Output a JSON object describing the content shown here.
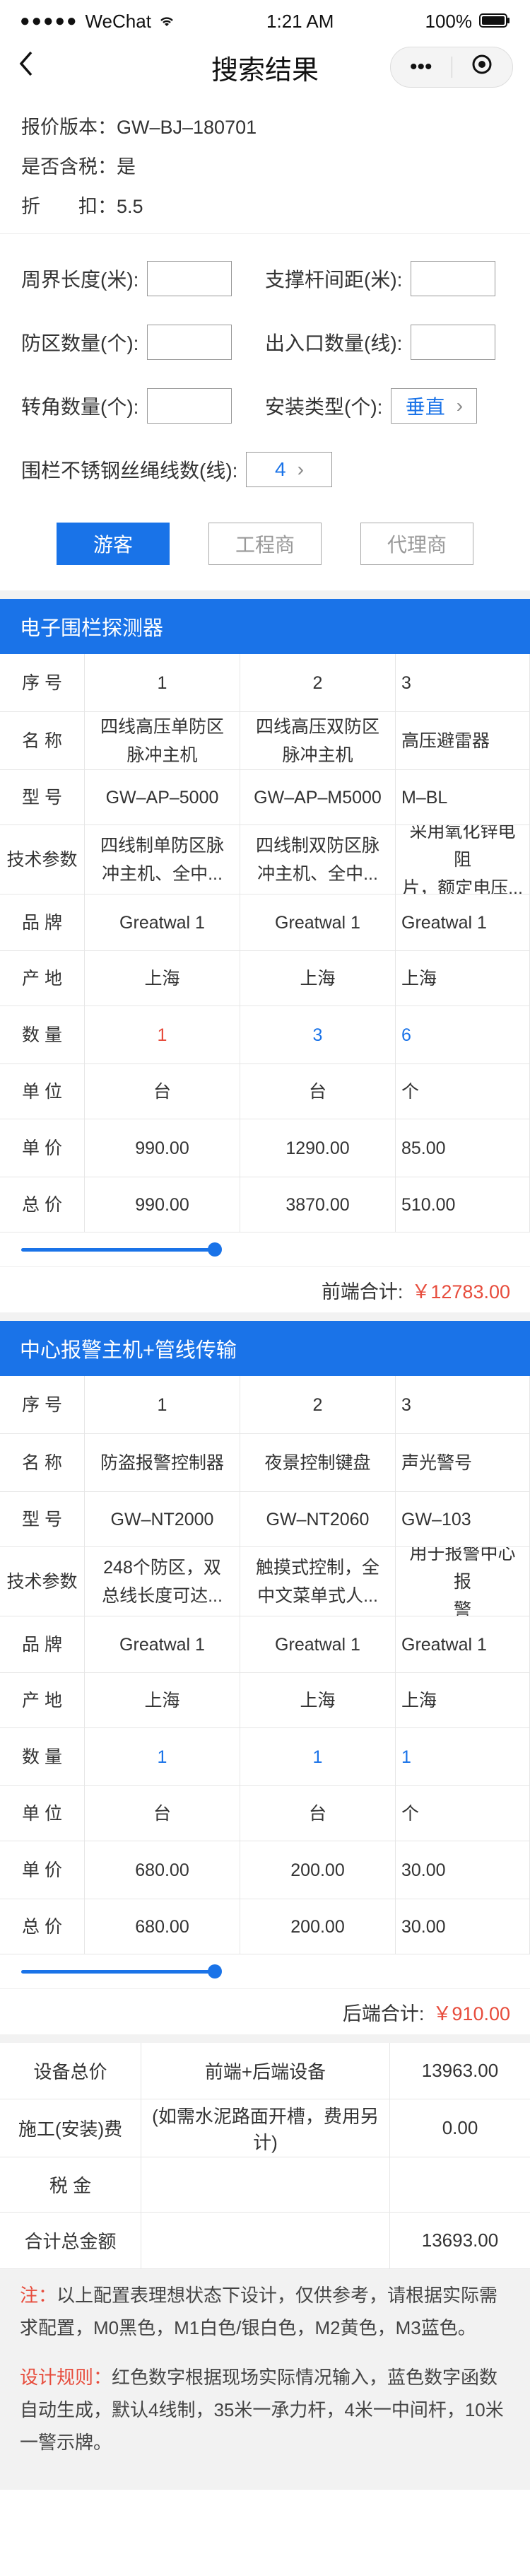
{
  "status": {
    "carrier": "WeChat",
    "time": "1:21 AM",
    "battery": "100%"
  },
  "nav": {
    "title": "搜索结果",
    "capsule_more": "•••",
    "capsule_close": "⊙"
  },
  "info": {
    "version_label": "报价版本：",
    "version": "GW–BJ–180701",
    "tax_label": "是否含税：",
    "tax": "是",
    "discount_label": "折　　扣：",
    "discount": "5.5"
  },
  "form": {
    "perimeter_label": "周界长度(米):",
    "pole_label": "支撑杆间距(米):",
    "zones_label": "防区数量(个):",
    "gates_label": "出入口数量(线):",
    "corners_label": "转角数量(个):",
    "install_label": "安装类型(个):",
    "install_value": "垂直",
    "wires_label": "围栏不锈钢丝绳线数(线):",
    "wires_value": "4"
  },
  "roles": {
    "tourist": "游客",
    "engineer": "工程商",
    "agent": "代理商"
  },
  "section1": {
    "title": "电子围栏探测器",
    "rows": [
      {
        "label": "序  号",
        "cells": [
          "1",
          "2",
          "3"
        ]
      },
      {
        "label": "名  称",
        "cells": [
          "四线高压单防区\n脉冲主机",
          "四线高压双防区\n脉冲主机",
          "高压避雷器"
        ]
      },
      {
        "label": "型  号",
        "cells": [
          "GW–AP–5000",
          "GW–AP–M5000",
          "M–BL"
        ]
      },
      {
        "label": "技术参数",
        "cells": [
          "四线制单防区脉\n冲主机、全中...",
          "四线制双防区脉\n冲主机、全中...",
          "采用氧化锌电阻\n片，额定电压..."
        ]
      },
      {
        "label": "品  牌",
        "cells": [
          "Greatwal 1",
          "Greatwal 1",
          "Greatwal 1"
        ]
      },
      {
        "label": "产  地",
        "cells": [
          "上海",
          "上海",
          "上海"
        ]
      },
      {
        "label": "数  量",
        "cells": [
          "1",
          "3",
          "6"
        ]
      },
      {
        "label": "单  位",
        "cells": [
          "台",
          "台",
          "个"
        ]
      },
      {
        "label": "单  价",
        "cells": [
          "990.00",
          "1290.00",
          "85.00"
        ]
      },
      {
        "label": "总  价",
        "cells": [
          "990.00",
          "3870.00",
          "510.00"
        ]
      }
    ],
    "subtotal_label": "前端合计:",
    "subtotal": "￥12783.00"
  },
  "section2": {
    "title": "中心报警主机+管线传输",
    "rows": [
      {
        "label": "序  号",
        "cells": [
          "1",
          "2",
          "3"
        ]
      },
      {
        "label": "名  称",
        "cells": [
          "防盗报警控制器",
          "夜景控制键盘",
          "声光警号"
        ]
      },
      {
        "label": "型  号",
        "cells": [
          "GW–NT2000",
          "GW–NT2060",
          "GW–103"
        ]
      },
      {
        "label": "技术参数",
        "cells": [
          "248个防区，双\n总线长度可达...",
          "触摸式控制，全\n中文菜单式人...",
          "用于报警中心报\n警"
        ]
      },
      {
        "label": "品  牌",
        "cells": [
          "Greatwal 1",
          "Greatwal 1",
          "Greatwal 1"
        ]
      },
      {
        "label": "产  地",
        "cells": [
          "上海",
          "上海",
          "上海"
        ]
      },
      {
        "label": "数  量",
        "cells": [
          "1",
          "1",
          "1"
        ]
      },
      {
        "label": "单  位",
        "cells": [
          "台",
          "台",
          "个"
        ]
      },
      {
        "label": "单  价",
        "cells": [
          "680.00",
          "200.00",
          "30.00"
        ]
      },
      {
        "label": "总  价",
        "cells": [
          "680.00",
          "200.00",
          "30.00"
        ]
      }
    ],
    "subtotal_label": "后端合计:",
    "subtotal": "￥910.00"
  },
  "totals": [
    {
      "label": "设备总价",
      "desc": "前端+后端设备",
      "value": "13963.00"
    },
    {
      "label": "施工(安装)费",
      "desc": "(如需水泥路面开槽，费用另计)",
      "value": "0.00"
    },
    {
      "label": "税  金",
      "desc": "",
      "value": ""
    },
    {
      "label": "合计总金额",
      "desc": "",
      "value": "13693.00"
    }
  ],
  "notes": {
    "note_label": "注：",
    "note_text": "以上配置表理想状态下设计，仅供参考，请根据实际需求配置，M0黑色，M1白色/银白色，M2黄色，M3蓝色。",
    "rule_label": "设计规则：",
    "rule_text": "红色数字根据现场实际情况输入，蓝色数字函数自动生成，默认4线制，35米一承力杆，4米一中间杆，10米一警示牌。"
  },
  "colors": {
    "primary": "#1a73e8",
    "red": "#e74c3c"
  }
}
